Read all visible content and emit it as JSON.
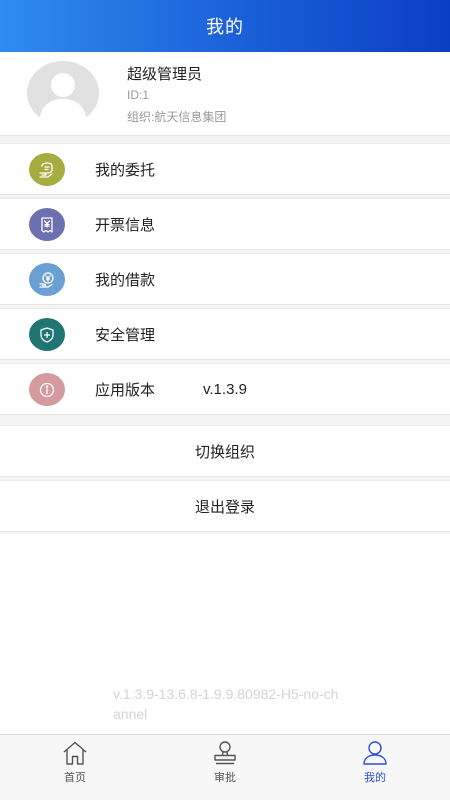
{
  "header": {
    "title": "我的"
  },
  "profile": {
    "name": "超级管理员",
    "id": "ID:1",
    "org": "组织:航天信息集团"
  },
  "menu": {
    "items": [
      {
        "label": "我的委托",
        "icon": "entrust-icon",
        "color": "#a6ac3f"
      },
      {
        "label": "开票信息",
        "icon": "invoice-icon",
        "color": "#6e6fae"
      },
      {
        "label": "我的借款",
        "icon": "loan-icon",
        "color": "#6aa0d2"
      },
      {
        "label": "安全管理",
        "icon": "shield-icon",
        "color": "#1e7573"
      },
      {
        "label": "应用版本",
        "value": "v.1.3.9",
        "icon": "info-icon",
        "color": "#d49a9e"
      }
    ]
  },
  "actions": {
    "switch_org": "切换组织",
    "logout": "退出登录"
  },
  "version_info": "v.1.3.9-13.6.8-1.9.9.80982-H5-no-channel",
  "tabbar": {
    "tabs": [
      {
        "label": "首页",
        "icon": "home-icon"
      },
      {
        "label": "审批",
        "icon": "stamp-icon"
      },
      {
        "label": "我的",
        "icon": "person-icon",
        "active": true
      }
    ],
    "active_color": "#2d4fd6"
  }
}
